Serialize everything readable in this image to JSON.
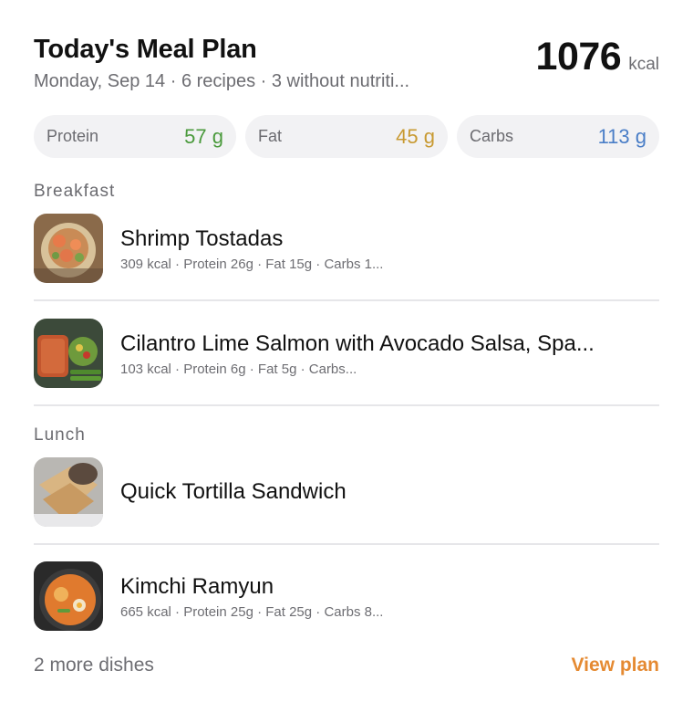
{
  "header": {
    "title": "Today's Meal Plan",
    "subtitle": "Monday, Sep 14 · 6 recipes · 3 without nutriti...",
    "kcal_value": "1076",
    "kcal_unit": "kcal"
  },
  "macros": [
    {
      "label": "Protein",
      "value": "57 g",
      "color": "#4a9a3c"
    },
    {
      "label": "Fat",
      "value": "45 g",
      "color": "#c89a32"
    },
    {
      "label": "Carbs",
      "value": "113 g",
      "color": "#4a7ec7"
    }
  ],
  "sections": [
    {
      "label": "Breakfast",
      "meals": [
        {
          "name": "Shrimp Tostadas",
          "meta": "309 kcal · Protein 26g · Fat 15g · Carbs 1...",
          "image_icon": "shrimp-tostadas-photo"
        },
        {
          "name": "Cilantro Lime Salmon with Avocado Salsa, Spa...",
          "meta": "103 kcal · Protein 6g · Fat 5g · Carbs...",
          "image_icon": "salmon-photo"
        }
      ]
    },
    {
      "label": "Lunch",
      "meals": [
        {
          "name": "Quick Tortilla Sandwich",
          "meta": "",
          "image_icon": "tortilla-sandwich-photo"
        },
        {
          "name": "Kimchi Ramyun",
          "meta": "665 kcal · Protein 25g · Fat 25g · Carbs 8...",
          "image_icon": "kimchi-ramyun-photo"
        }
      ]
    }
  ],
  "footer": {
    "more_dishes": "2 more dishes",
    "view_plan": "View plan"
  },
  "colors": {
    "accent": "#e58a32",
    "protein": "#4a9a3c",
    "fat": "#c89a32",
    "carbs": "#4a7ec7"
  }
}
